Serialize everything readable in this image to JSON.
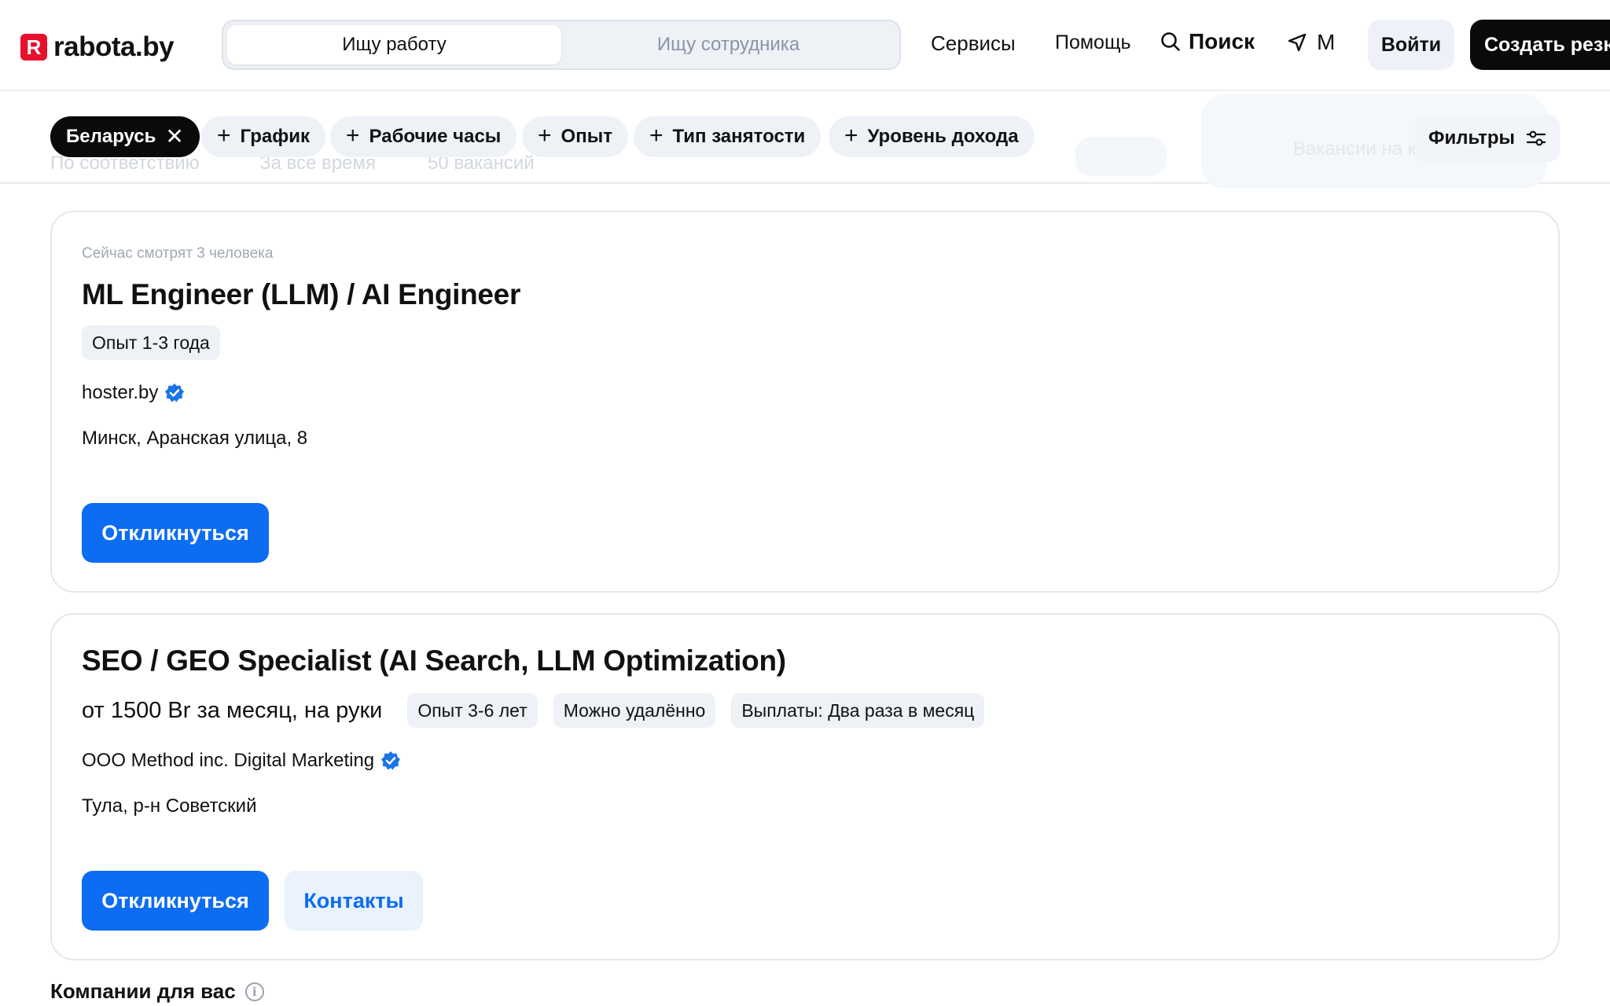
{
  "header": {
    "logo_mark": "R",
    "logo_text": "rabota.by",
    "role_tabs": [
      "Ищу работу",
      "Ищу сотрудника"
    ],
    "nav": {
      "services": "Сервисы",
      "help": "Помощь",
      "search": "Поиск",
      "city": "М"
    },
    "login": "Войти",
    "create_resume": "Создать резюме"
  },
  "background_ghost": {
    "sort": "По соответствию",
    "period": "За все время",
    "count": "50 вакансий",
    "map_label": "Вакансии на карте"
  },
  "filters": {
    "region": "Беларусь",
    "chips": [
      "График",
      "Рабочие часы",
      "Опыт",
      "Тип занятости",
      "Уровень дохода"
    ],
    "filters_button": "Фильтры"
  },
  "vacancies": [
    {
      "watching": "Сейчас смотрят 3 человека",
      "title": "ML Engineer (LLM) / AI Engineer",
      "tags": [
        "Опыт 1-3 года"
      ],
      "company": "hoster.by",
      "address": "Минск, Аранская улица, 8",
      "respond": "Откликнуться"
    },
    {
      "title": "SEO / GEO Specialist (AI Search, LLM Optimization)",
      "salary": "от 1500 Br за месяц, на руки",
      "tags": [
        "Опыт 3-6 лет",
        "Можно удалённо",
        "Выплаты: Два раза в месяц"
      ],
      "company": "ООО Method inc. Digital Marketing",
      "address": "Тула, р-н Советский",
      "respond": "Откликнуться",
      "contacts": "Контакты"
    }
  ],
  "companies_section": {
    "title": "Компании для вас"
  },
  "colors": {
    "brand_red": "#e8112d",
    "accent_blue": "#0c6cf2",
    "verified_blue": "#1a73e8"
  }
}
